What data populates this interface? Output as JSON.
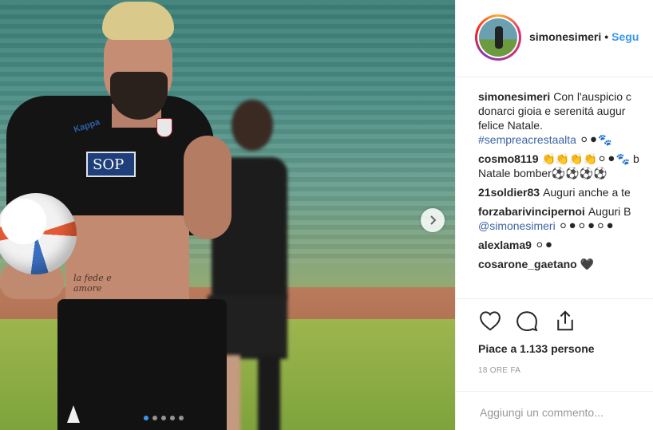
{
  "post": {
    "username": "simonesimeri",
    "separator": "•",
    "follow_label": "Segu"
  },
  "photo": {
    "sponsor_text": "SOP",
    "brand_text": "Kappa",
    "tattoo_text": "la fede e amore",
    "carousel_total": 5,
    "carousel_active": 1
  },
  "comments": {
    "caption": {
      "user": "simonesimeri",
      "text_line1": "Con l'auspicio c",
      "text_line2": "donarci gioia e serenitá augur",
      "text_line3": "felice Natale.",
      "hashtag": "#sempreacrestaalta",
      "emoji": "⚪⚫🐾"
    },
    "items": [
      {
        "user": "cosmo8119",
        "text": "👏👏👏👏⚪⚫🐾 b",
        "text2": "Natale bomber⚽⚽⚽⚽"
      },
      {
        "user": "21soldier83",
        "text": "Auguri anche a te"
      },
      {
        "user": "forzabarivincipernoi",
        "text": "Auguri B",
        "mention": "@simonesimeri",
        "emoji": "⚪⚫⚪⚫⚪⚫"
      },
      {
        "user": "alexlama9",
        "text": "⚪⚫"
      },
      {
        "user": "cosarone_gaetano",
        "text": "🖤"
      }
    ]
  },
  "actions": {
    "likes_text": "Piace a 1.133 persone",
    "time_text": "18 ORE FA"
  },
  "add_comment": {
    "placeholder": "Aggiungi un commento..."
  }
}
